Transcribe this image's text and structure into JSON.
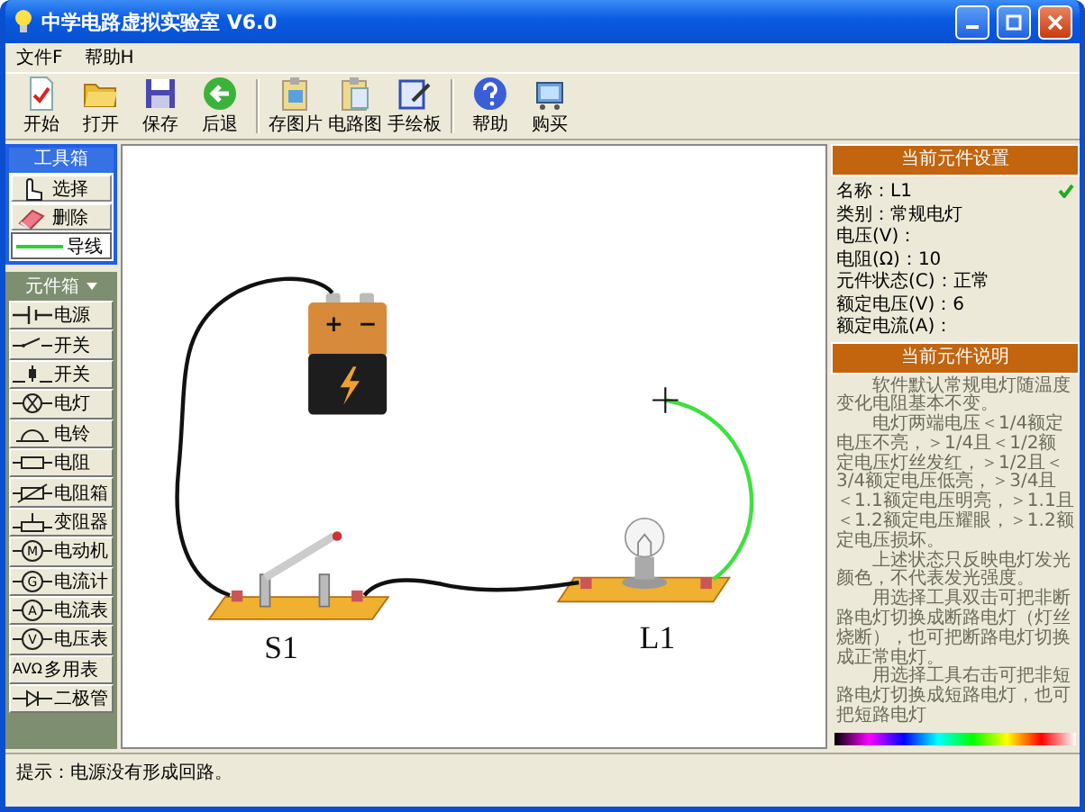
{
  "window": {
    "title": "中学电路虚拟实验室  V6.0"
  },
  "menu": [
    "文件F",
    "帮助H"
  ],
  "toolbar": [
    [
      "开始",
      "打开",
      "保存",
      "后退"
    ],
    [
      "存图片",
      "电路图",
      "手绘板"
    ],
    [
      "帮助",
      "购买"
    ]
  ],
  "toolbox": {
    "title": "工具箱",
    "items": [
      {
        "label": "选择",
        "selected": false
      },
      {
        "label": "删除",
        "selected": false
      },
      {
        "label": "导线",
        "selected": true
      }
    ]
  },
  "component_box": {
    "title": "元件箱",
    "items": [
      {
        "label": "电源"
      },
      {
        "label": "开关"
      },
      {
        "label": "开关"
      },
      {
        "label": "电灯"
      },
      {
        "label": "电铃"
      },
      {
        "label": "电阻"
      },
      {
        "label": "电阻箱"
      },
      {
        "label": "变阻器"
      },
      {
        "label": "电动机",
        "symbol": "M"
      },
      {
        "label": "电流计",
        "symbol": "G"
      },
      {
        "label": "电流表",
        "symbol": "A"
      },
      {
        "label": "电压表",
        "symbol": "V"
      },
      {
        "label": "多用表",
        "symbol": "AVΩ"
      },
      {
        "label": "二极管"
      }
    ]
  },
  "canvas": {
    "wires": [
      {
        "selected": false
      },
      {
        "selected": false
      },
      {
        "selected": true
      }
    ],
    "battery": {
      "terminals": [
        "+",
        "−"
      ]
    },
    "switch": {
      "label": "S1"
    },
    "bulb": {
      "label": "L1"
    }
  },
  "settings": {
    "title": "当前元件设置",
    "rows": [
      "名称：L1",
      "类别：常规电灯",
      "电压(V)：",
      "电阻(Ω)：10",
      "元件状态(C)：正常",
      "额定电压(V)：6",
      "额定电流(A)："
    ]
  },
  "description": {
    "title": "当前元件说明",
    "paragraphs": [
      "软件默认常规电灯随温度变化电阻基本不变。",
      "电灯两端电压＜1/4额定电压不亮，＞1/4且＜1/2额定电压灯丝发红，＞1/2且＜3/4额定电压低亮，＞3/4且＜1.1额定电压明亮，＞1.1且＜1.2额定电压耀眼，＞1.2额定电压损坏。",
      "上述状态只反映电灯发光颜色，不代表发光强度。",
      "用选择工具双击可把非断路电灯切换成断路电灯（灯丝烧断），也可把断路电灯切换成正常电灯。",
      "用选择工具右击可把非短路电灯切换成短路电灯，也可把短路电灯"
    ]
  },
  "status_bar": {
    "text": "提示：电源没有形成回路。"
  }
}
